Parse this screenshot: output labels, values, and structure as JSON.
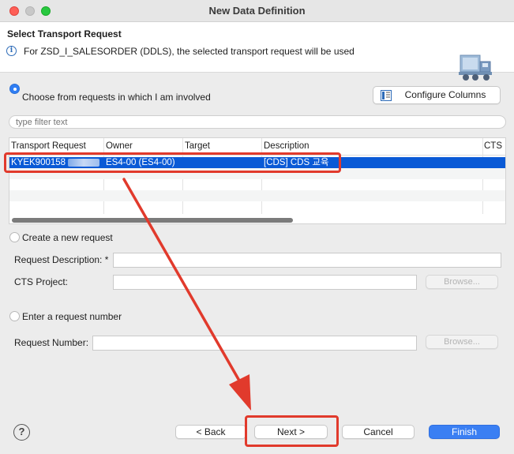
{
  "window": {
    "title": "New Data Definition"
  },
  "header": {
    "title": "Select Transport Request",
    "message": "For ZSD_I_SALESORDER (DDLS), the selected transport request will be used"
  },
  "option_involved": {
    "label": "Choose from requests in which I am involved",
    "selected": true
  },
  "configure_columns": {
    "label": "Configure Columns"
  },
  "filter": {
    "placeholder": "type filter text"
  },
  "table": {
    "columns": [
      "Transport Request",
      "Owner",
      "Target",
      "Description",
      "CTS P"
    ],
    "rows": [
      {
        "request": "KYEK900158",
        "owner": "ES4-00 (ES4-00)",
        "target": "",
        "description": "[CDS] CDS 교육",
        "selected": true
      }
    ]
  },
  "option_new": {
    "label": "Create a new request",
    "selected": false,
    "request_description_label": "Request Description: *",
    "request_description_value": "",
    "cts_project_label": "CTS Project:",
    "cts_project_value": "",
    "browse_label": "Browse..."
  },
  "option_number": {
    "label": "Enter a request number",
    "selected": false,
    "request_number_label": "Request Number:",
    "request_number_value": "",
    "browse_label": "Browse..."
  },
  "footer": {
    "help": "?",
    "back": "< Back",
    "next": "Next >",
    "cancel": "Cancel",
    "finish": "Finish"
  },
  "colors": {
    "selection": "#0a5ad6",
    "annotation": "#e13a2c",
    "primary_button": "#3a7ff3"
  }
}
